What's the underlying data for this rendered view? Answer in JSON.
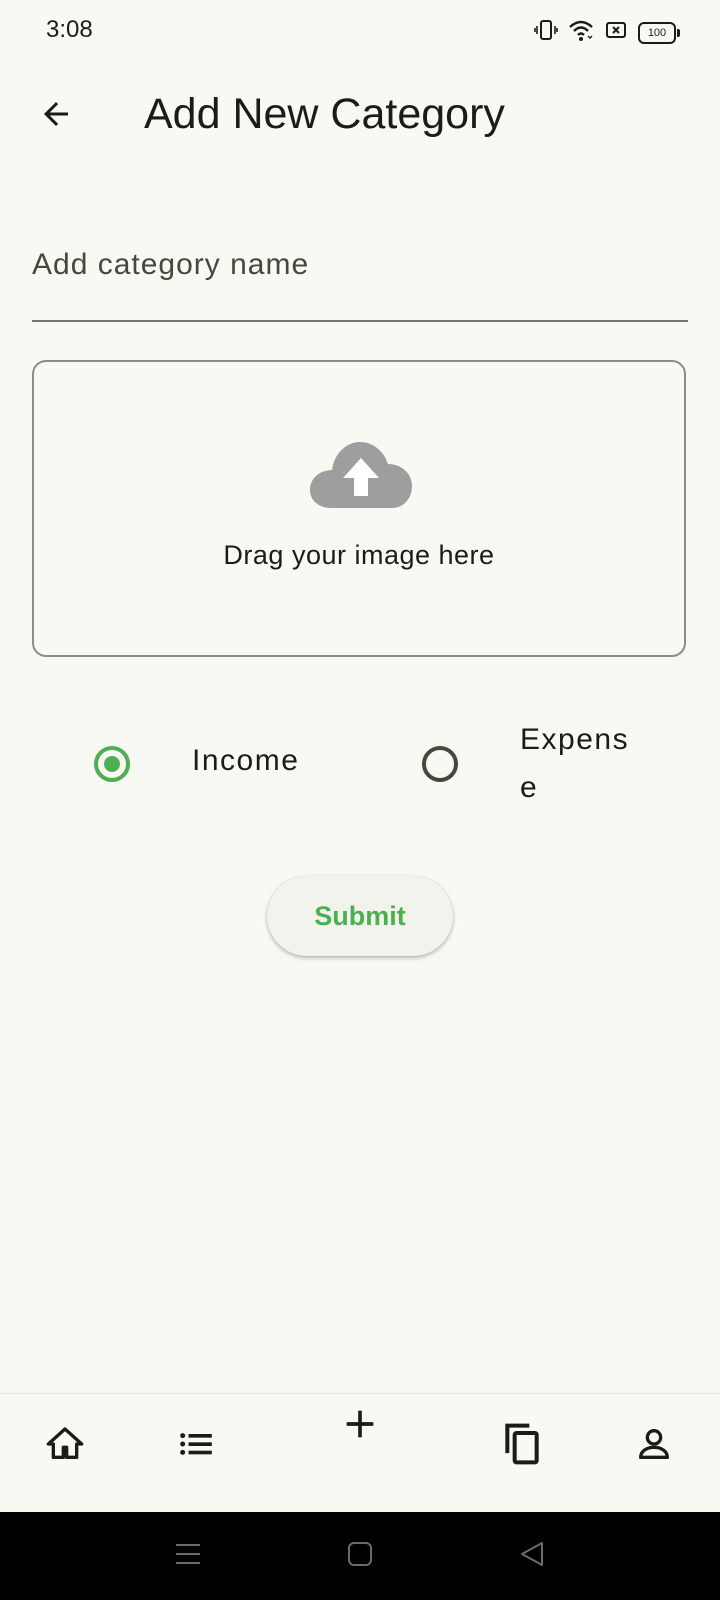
{
  "status_bar": {
    "time": "3:08",
    "battery_level": "100",
    "icons": [
      "vibrate-icon",
      "wifi-icon",
      "no-sim-icon",
      "battery-icon"
    ]
  },
  "app_bar": {
    "title": "Add New Category",
    "back_icon": "arrow-back-icon"
  },
  "form": {
    "name_placeholder": "Add category name",
    "name_value": "",
    "upload_icon": "cloud-upload-icon",
    "upload_text": "Drag your image here",
    "type_options": [
      {
        "label": "Income",
        "selected": true
      },
      {
        "label": "Expense",
        "selected": false
      }
    ],
    "submit_label": "Submit"
  },
  "bottom_nav": {
    "items": [
      {
        "icon": "home-icon"
      },
      {
        "icon": "list-icon"
      },
      {
        "icon": "add-icon"
      },
      {
        "icon": "copy-icon"
      },
      {
        "icon": "profile-icon"
      }
    ]
  },
  "system_nav": {
    "buttons": [
      "menu-icon",
      "home-square-icon",
      "back-triangle-icon"
    ]
  },
  "colors": {
    "background": "#f7f9f2",
    "accent": "#4caf50",
    "text": "#1b1c19",
    "outline": "#74776f",
    "upload_icon": "#9e9e9e"
  }
}
